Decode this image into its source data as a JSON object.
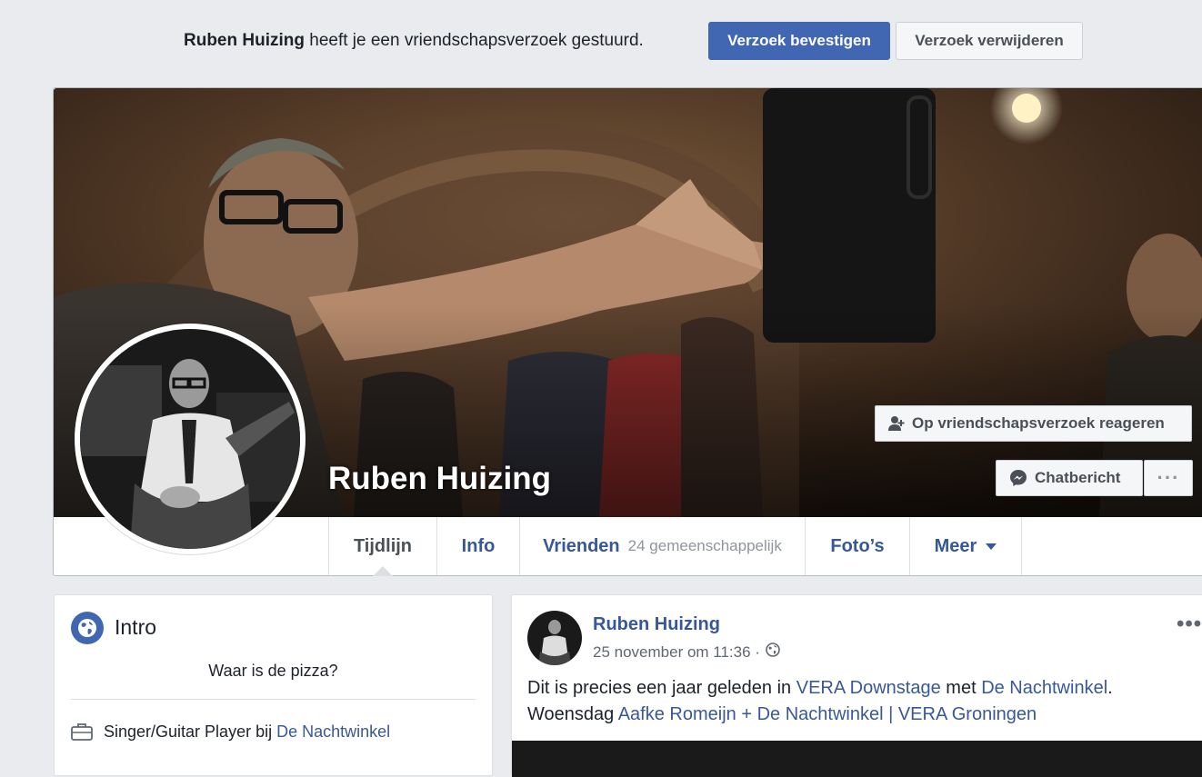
{
  "friend_request": {
    "name": "Ruben Huizing",
    "message": "heeft je een vriendschapsverzoek gestuurd.",
    "confirm_label": "Verzoek bevestigen",
    "delete_label": "Verzoek verwijderen"
  },
  "profile": {
    "name": "Ruben Huizing",
    "respond_label": "Op vriendschapsverzoek reageren",
    "message_label": "Chatbericht",
    "more_label": "···"
  },
  "tabs": [
    {
      "label": "Tijdlijn",
      "active": true
    },
    {
      "label": "Info"
    },
    {
      "label": "Vrienden",
      "sub": "24 gemeenschappelijk"
    },
    {
      "label": "Foto’s"
    },
    {
      "label": "Meer"
    }
  ],
  "intro": {
    "title": "Intro",
    "bio": "Waar is de pizza?",
    "job_prefix": "Singer/Guitar Player bij",
    "job_link": "De Nachtwinkel"
  },
  "post": {
    "author": "Ruben Huizing",
    "date": "25 november om 11:36 ·",
    "menu": "•••",
    "text_1": "Dit is precies een jaar geleden in",
    "link_1": "VERA Downstage",
    "text_2": "met",
    "link_2": "De Nachtwinkel",
    "text_3": ".",
    "text_4": "Woensdag",
    "link_3": "Aafke Romeijn + De Nachtwinkel | VERA Groningen"
  },
  "colors": {
    "primary": "#4267b2",
    "link": "#385898",
    "background": "#e9ebee"
  },
  "icons": [
    "add-friend-icon",
    "messenger-icon",
    "globe-icon",
    "briefcase-icon",
    "public-globe-icon",
    "dropdown-caret-icon"
  ]
}
